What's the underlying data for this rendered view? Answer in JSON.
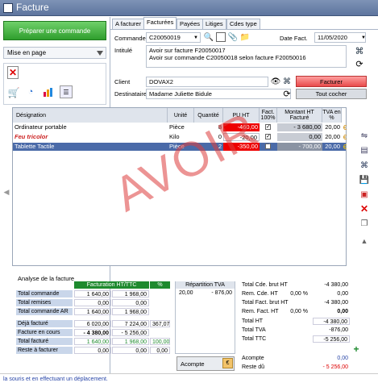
{
  "window": {
    "title": "Facture"
  },
  "left": {
    "prepare_button": "Préparer une commande",
    "layout_select": "Mise en page"
  },
  "tabs": [
    "A facturer",
    "Facturées",
    "Payées",
    "Litiges",
    "Cdes type"
  ],
  "form": {
    "commande_label": "Commande",
    "commande_value": "C20050019",
    "date_label": "Date Fact.",
    "date_value": "11/05/2020",
    "intitule_label": "Intitulé",
    "intitule_line1": "Avoir sur facture F20050017",
    "intitule_line2": "Avoir sur commande C20050018 selon facture F20050016",
    "client_label": "Client",
    "client_value": "DOVAX2",
    "destinataire_label": "Destinataire",
    "destinataire_value": "Madame Juliette Bidule",
    "facturer_button": "Facturer",
    "toutcocher_button": "Tout cocher"
  },
  "grid": {
    "headers": {
      "designation": "Désignation",
      "unite": "Unité",
      "quantite": "Quantité",
      "puht": "PU HT",
      "fact": "Fact. 100%",
      "montant": "Montant HT Facturé",
      "tva": "TVA en %"
    },
    "rows": [
      {
        "designation": "Ordinateur portable",
        "unite": "Pièce",
        "quantite": "8",
        "puht": "-460,00",
        "montant": "- 3 680,00",
        "tva": "20,00"
      },
      {
        "designation": "Feu tricolor",
        "unite": "Kilo",
        "quantite": "0",
        "puht": "-20,00",
        "montant": "0,00",
        "tva": "20,00"
      },
      {
        "designation": "Tablette Tactile",
        "unite": "Pièce",
        "quantite": "2",
        "puht": "-350,00",
        "montant": "- 700,00",
        "tva": "20,00"
      }
    ],
    "watermark": "AVOIR"
  },
  "analyse": {
    "title": "Analyse de la facture",
    "header_fact": "Facturation HT/TTC",
    "header_pct": "%",
    "rows": [
      {
        "label": "Total commande",
        "ht": "1 640,00",
        "ttc": "1 968,00",
        "pct": ""
      },
      {
        "label": "Total remises",
        "ht": "0,00",
        "ttc": "0,00",
        "pct": ""
      },
      {
        "label": "Total commande AR",
        "ht": "1 640,00",
        "ttc": "1 968,00",
        "pct": ""
      },
      {
        "label": "Déjà facturé",
        "ht": "6 020,00",
        "ttc": "7 224,00",
        "pct": "367,07"
      },
      {
        "label": "Facture en cours",
        "ht": "- 4 380,00",
        "ttc": "- 5 256,00",
        "pct": ""
      },
      {
        "label": "Total facturé",
        "ht": "1 640,00",
        "ttc": "1 968,00",
        "pct": "100,00"
      },
      {
        "label": "Reste à facturer",
        "ht": "0,00",
        "ttc": "0,00",
        "pct": "0,00"
      }
    ]
  },
  "repartition": {
    "title": "Répartition TVA",
    "rate": "20,00",
    "amount": "- 876,00",
    "acompte_button": "Acompte"
  },
  "totals": {
    "rows": [
      {
        "label": "Total Cde. brut HT",
        "pct": "",
        "value": "-4 380,00"
      },
      {
        "label": "Rem. Cde. HT",
        "pct": "0,00 %",
        "value": "0,00"
      },
      {
        "label": "Total Fact. brut HT",
        "pct": "",
        "value": "-4 380,00"
      },
      {
        "label": "Rem. Fact. HT",
        "pct": "0,00 %",
        "value": "0,00"
      },
      {
        "label": "Total HT",
        "pct": "",
        "value": "-4 380,00"
      },
      {
        "label": "Total TVA",
        "pct": "",
        "value": "-876,00"
      },
      {
        "label": "Total TTC",
        "pct": "",
        "value": "-5 256,00"
      }
    ],
    "acompte_label": "Acompte",
    "acompte_value": "0,00",
    "reste_label": "Reste dû",
    "reste_value": "- 5 256,00"
  },
  "status": "la souris et en effectuant un déplacement.",
  "colors": {
    "title_bg": "#6b80a8",
    "green": "#2f9e2d",
    "red": "#e84a4a",
    "selected_row": "#4a6aa8"
  }
}
